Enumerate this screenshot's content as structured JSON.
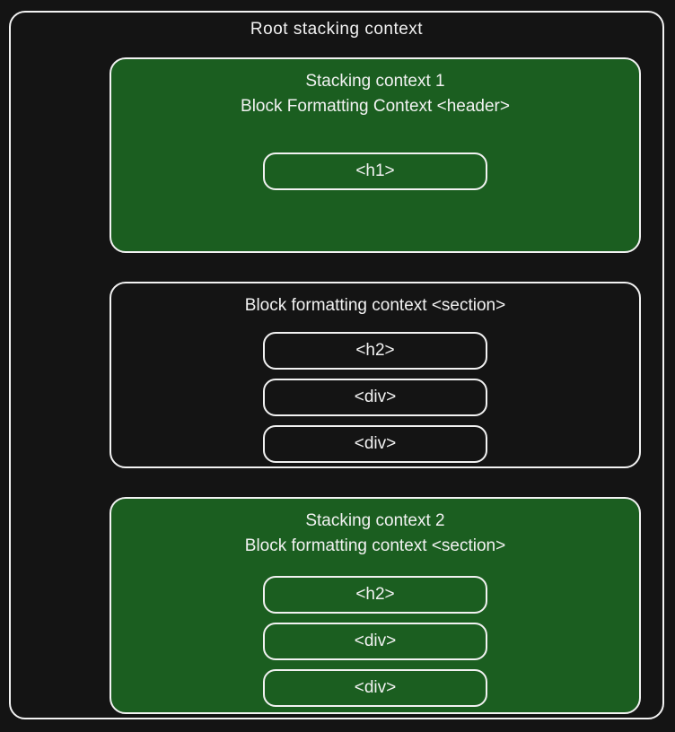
{
  "colors": {
    "background": "#141414",
    "outline": "#f2f2f2",
    "stackingContext": "#1b5e20"
  },
  "root": {
    "title": "Root stacking context"
  },
  "block1": {
    "title1": "Stacking context 1",
    "title2": "Block Formatting Context <header>",
    "child": "<h1>"
  },
  "block2": {
    "title": "Block formatting context <section>",
    "child1": "<h2>",
    "child2": "<div>",
    "child3": "<div>"
  },
  "block3": {
    "title1": "Stacking context 2",
    "title2": "Block formatting context <section>",
    "child1": "<h2>",
    "child2": "<div>",
    "child3": "<div>"
  }
}
